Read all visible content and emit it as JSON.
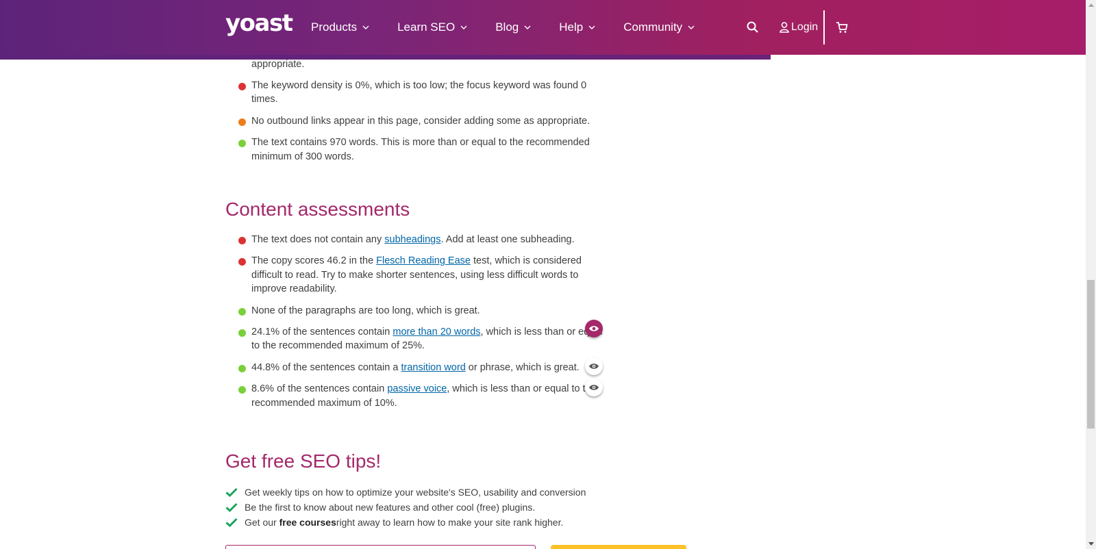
{
  "header": {
    "logo": "yoast",
    "nav": [
      {
        "label": "Products"
      },
      {
        "label": "Learn SEO"
      },
      {
        "label": "Blog"
      },
      {
        "label": "Help"
      },
      {
        "label": "Community"
      }
    ],
    "login_label": "Login"
  },
  "seo_list": {
    "cut_text": "appropriate.",
    "items": [
      {
        "status": "red",
        "parts": [
          "The keyword density is 0%, which is too low; the focus keyword was found 0 times."
        ]
      },
      {
        "status": "orange",
        "parts": [
          "No outbound links appear in this page, consider adding some as appropriate."
        ]
      },
      {
        "status": "green",
        "parts": [
          "The text contains 970 words. This is more than or equal to the recommended minimum of 300 words."
        ]
      }
    ]
  },
  "content_assessments": {
    "heading": "Content assessments",
    "items": [
      {
        "pre": "The text does not contain any ",
        "link": "subheadings",
        "post": ". Add at least one subheading."
      },
      {
        "pre": "The copy scores 46.2 in the ",
        "link": "Flesch Reading Ease",
        "post": " test, which is considered difficult to read. Try to make shorter sentences, using less difficult words to improve readability."
      },
      {
        "pre": "None of the paragraphs are too long, which is great.",
        "link": "",
        "post": ""
      },
      {
        "pre": "24.1% of the sentences contain ",
        "link": "more than 20 words",
        "post": ", which is less than or equal to the recommended maximum of 25%."
      },
      {
        "pre": "44.8% of the sentences contain a ",
        "link": "transition word",
        "post": " or phrase, which is great."
      },
      {
        "pre": "8.6% of the sentences contain ",
        "link": "passive voice",
        "post": ", which is less than or equal to the recommended maximum of 10%."
      }
    ]
  },
  "seo_tips": {
    "heading": "Get free SEO tips!",
    "items": [
      {
        "pre": "Get weekly tips on how to optimize your website's SEO, usability and conversion",
        "bold": "",
        "post": ""
      },
      {
        "pre": "Be the first to know about new features and other cool (free) plugins.",
        "bold": "",
        "post": ""
      },
      {
        "pre": "Get our ",
        "bold": "free courses",
        "post": " right away to learn how to make your site rank higher."
      }
    ]
  },
  "colors": {
    "brand": "#a4286a",
    "header_start": "#5d237a",
    "red": "#dc3232",
    "orange": "#ee7c1b",
    "green": "#7ad03a",
    "link": "#0066a8",
    "check": "#1aa55e",
    "cta": "#fec228"
  }
}
